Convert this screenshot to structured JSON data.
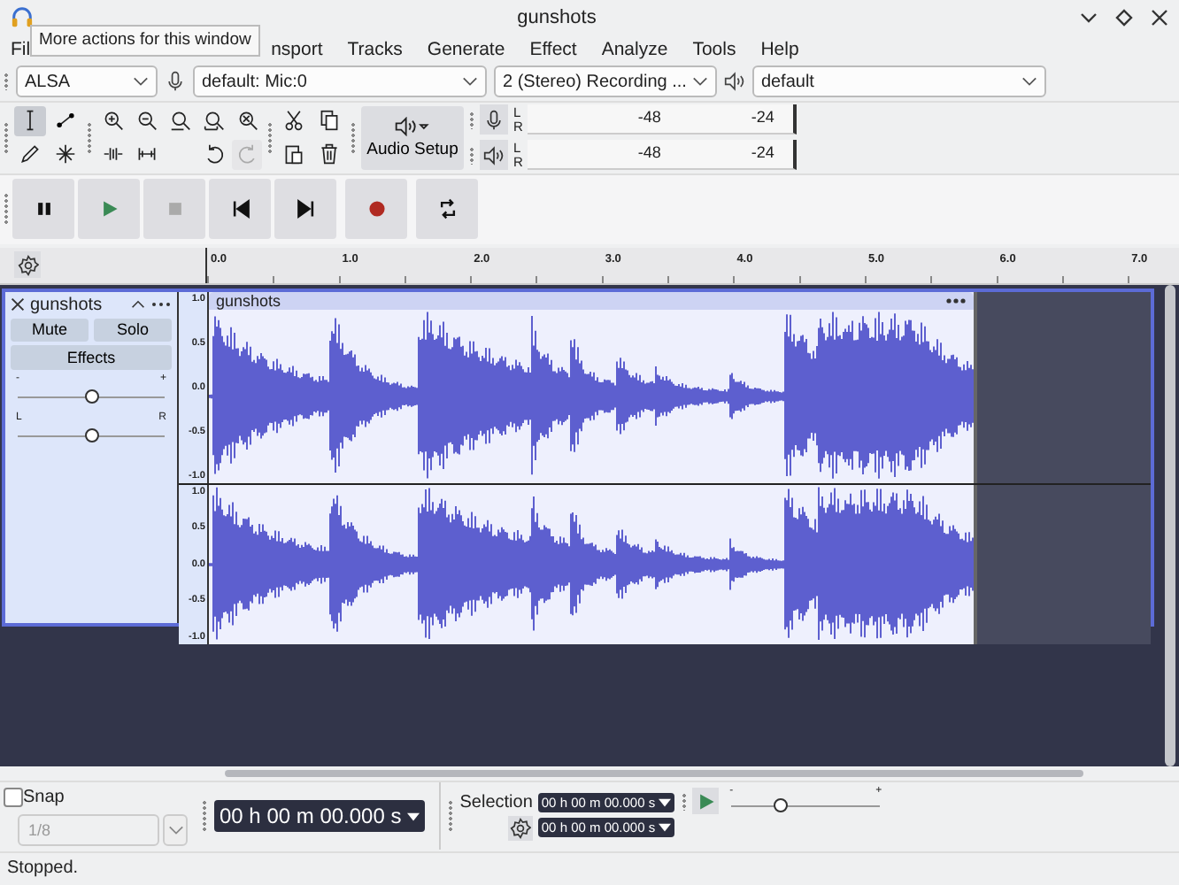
{
  "window": {
    "title": "gunshots"
  },
  "menu": {
    "items": [
      "Fil",
      "nsport",
      "Tracks",
      "Generate",
      "Effect",
      "Analyze",
      "Tools",
      "Help"
    ],
    "tooltip": "More actions for this window"
  },
  "device_toolbar": {
    "host": "ALSA",
    "recording_device": "default: Mic:0",
    "recording_channels": "2 (Stereo) Recording ...",
    "playback_device": "default"
  },
  "tools": [
    {
      "kind": "select",
      "selected": true
    },
    {
      "kind": "envelope",
      "selected": false
    },
    {
      "kind": "draw",
      "selected": false
    },
    {
      "kind": "multi",
      "selected": false
    }
  ],
  "edit_buttons": [
    {
      "kind": "undo",
      "disabled": false
    },
    {
      "kind": "redo",
      "disabled": true
    }
  ],
  "audio_setup": {
    "label": "Audio Setup"
  },
  "meters": [
    {
      "kind": "record",
      "left": "L",
      "right": "R",
      "ticks": [
        "-48",
        "-24"
      ]
    },
    {
      "kind": "play",
      "left": "L",
      "right": "R",
      "ticks": [
        "-48",
        "-24"
      ]
    }
  ],
  "transport": [
    {
      "kind": "pause",
      "disabled": false
    },
    {
      "kind": "play",
      "disabled": false
    },
    {
      "kind": "stop",
      "disabled": true
    },
    {
      "kind": "skip-start",
      "disabled": false
    },
    {
      "kind": "skip-end",
      "disabled": false
    },
    {
      "kind": "record",
      "disabled": false
    },
    {
      "kind": "loop",
      "disabled": false
    }
  ],
  "ruler": {
    "ticks": [
      "0.0",
      "1.0",
      "2.0",
      "3.0",
      "4.0",
      "5.0",
      "6.0",
      "7.0"
    ]
  },
  "track": {
    "name": "gunshots",
    "mute": "Mute",
    "solo": "Solo",
    "effects": "Effects",
    "gain": {
      "minus": "-",
      "plus": "+",
      "level": 0.5
    },
    "pan": {
      "left": "L",
      "right": "R",
      "level": 0.5
    },
    "clip_name": "gunshots",
    "channels": [
      {
        "scale": [
          "1.0",
          "0.5",
          "0.0",
          "-0.5",
          "-1.0"
        ]
      },
      {
        "scale": [
          "1.0",
          "0.5",
          "0.0",
          "-0.5",
          "-1.0"
        ]
      }
    ]
  },
  "bottom": {
    "snap": {
      "label": "Snap",
      "checked": false
    },
    "snap_value": "1/8",
    "time": "00 h 00 m 00.000 s",
    "selection_label": "Selection",
    "selection_start": "00 h 00 m 00.000 s",
    "selection_end": "00 h 00 m 00.000 s",
    "play_speed": {
      "minus": "-",
      "plus": "+",
      "level": 0.33
    }
  },
  "status_bar": "Stopped."
}
